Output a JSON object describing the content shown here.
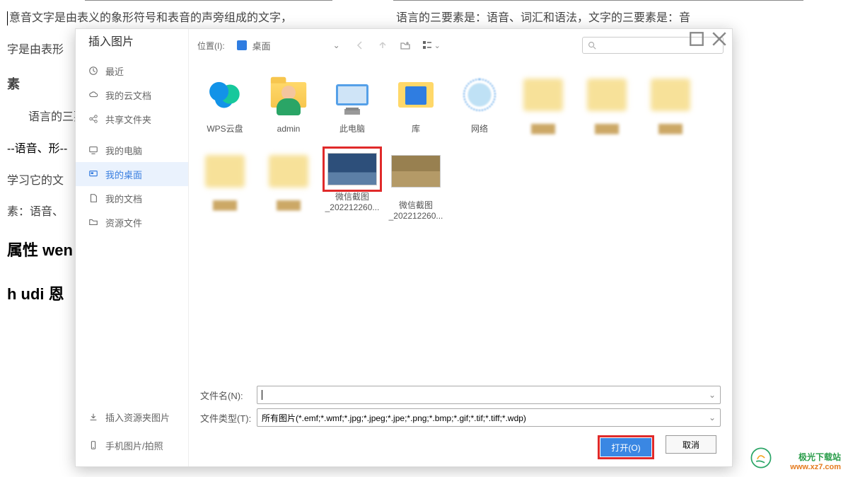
{
  "bg": {
    "left": {
      "line1": "意音文字是由表义的象形符号和表音的声旁组成的文字，",
      "line2": "字是由表形",
      "heading": "素",
      "line3": "语言的三要",
      "line4": "--语音、形--",
      "line5": "学习它的文",
      "line6": "素：语音、",
      "bold1": "属性 wen",
      "bold2": "h udi  恩"
    },
    "right": {
      "line1": "语言的三要素是：语音、词汇和语法，文字的三要素是：音"
    }
  },
  "dialog": {
    "title": "插入图片",
    "sidebar": {
      "recent": "最近",
      "mydocs_cloud": "我的云文档",
      "shared": "共享文件夹",
      "mypc": "我的电脑",
      "mydesk": "我的桌面",
      "mydocs": "我的文档",
      "resources": "资源文件",
      "foot1": "插入资源夹图片",
      "foot2": "手机图片/拍照"
    },
    "toolbar": {
      "loc_label": "位置(I):",
      "loc_value": "桌面"
    },
    "files": {
      "wpscloud": "WPS云盘",
      "admin": "admin",
      "thispc": "此电脑",
      "lib": "库",
      "net": "网络",
      "wx1a": "微信截图",
      "wx1b": "_202212260...",
      "wx2a": "微信截图",
      "wx2b": "_202212260..."
    },
    "bottom": {
      "fname_label": "文件名(N):",
      "ftype_label": "文件类型(T):",
      "ftype_value": "所有图片(*.emf;*.wmf;*.jpg;*.jpeg;*.jpe;*.png;*.bmp;*.gif;*.tif;*.tiff;*.wdp)",
      "open": "打开(O)",
      "cancel": "取消"
    }
  },
  "watermark": {
    "site": "极光下载站",
    "url": "www.xz7.com"
  }
}
